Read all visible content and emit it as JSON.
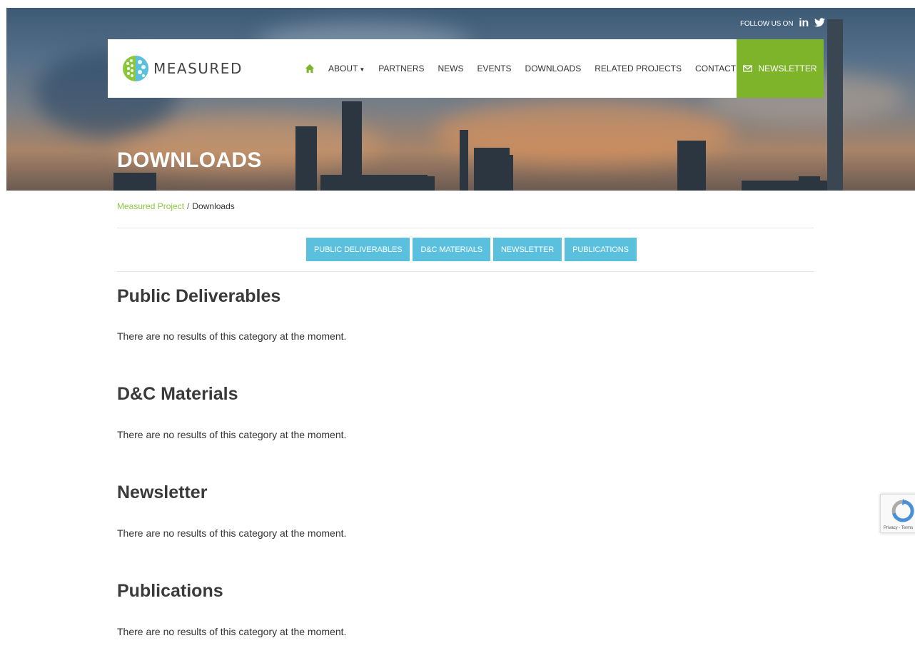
{
  "header": {
    "follow_label": "FOLLOW US ON",
    "linkedin_label": "in",
    "page_title": "DOWNLOADS"
  },
  "brand": {
    "name": "MEASURED",
    "accent": "#7db42a",
    "link_color": "#8cc63f",
    "filter_color": "#5bc0de"
  },
  "nav": {
    "items": [
      "ABOUT",
      "PARTNERS",
      "NEWS",
      "EVENTS",
      "DOWNLOADS",
      "RELATED PROJECTS",
      "CONTACT"
    ],
    "newsletter_label": "NEWSLETTER"
  },
  "breadcrumb": {
    "home": "Measured Project",
    "separator": "/",
    "current": "Downloads"
  },
  "filters": [
    "PUBLIC DELIVERABLES",
    "D&C MATERIALS",
    "NEWSLETTER",
    "PUBLICATIONS"
  ],
  "sections": [
    {
      "title": "Public Deliverables",
      "text": "There are no results of this category at the moment."
    },
    {
      "title": "D&C Materials",
      "text": "There are no results of this category at the moment."
    },
    {
      "title": "Newsletter",
      "text": "There are no results of this category at the moment."
    },
    {
      "title": "Publications",
      "text": "There are no results of this category at the moment."
    }
  ],
  "recaptcha": {
    "label": "Privacy - Terms"
  }
}
